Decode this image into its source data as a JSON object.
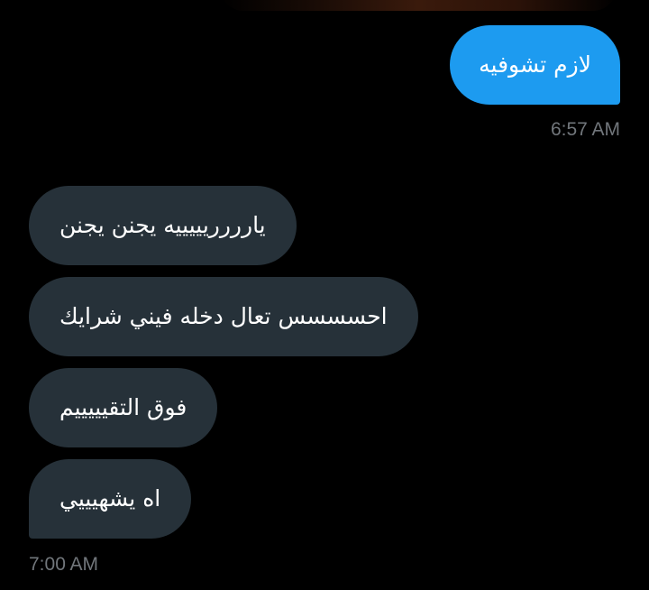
{
  "conversation": {
    "sent": {
      "text": "لازم تشوفيه",
      "time": "6:57 AM"
    },
    "received": [
      {
        "text": "يارررريييييه يجنن يجنن"
      },
      {
        "text": "احسسسس تعال دخله فيني شرايك"
      },
      {
        "text": "فوق التقيييييم"
      },
      {
        "text": "اه يشهيييي"
      }
    ],
    "received_time": "7:00 AM"
  },
  "colors": {
    "background": "#000000",
    "sent_bubble": "#1d9bf0",
    "received_bubble": "#263139",
    "timestamp": "#71767b"
  }
}
